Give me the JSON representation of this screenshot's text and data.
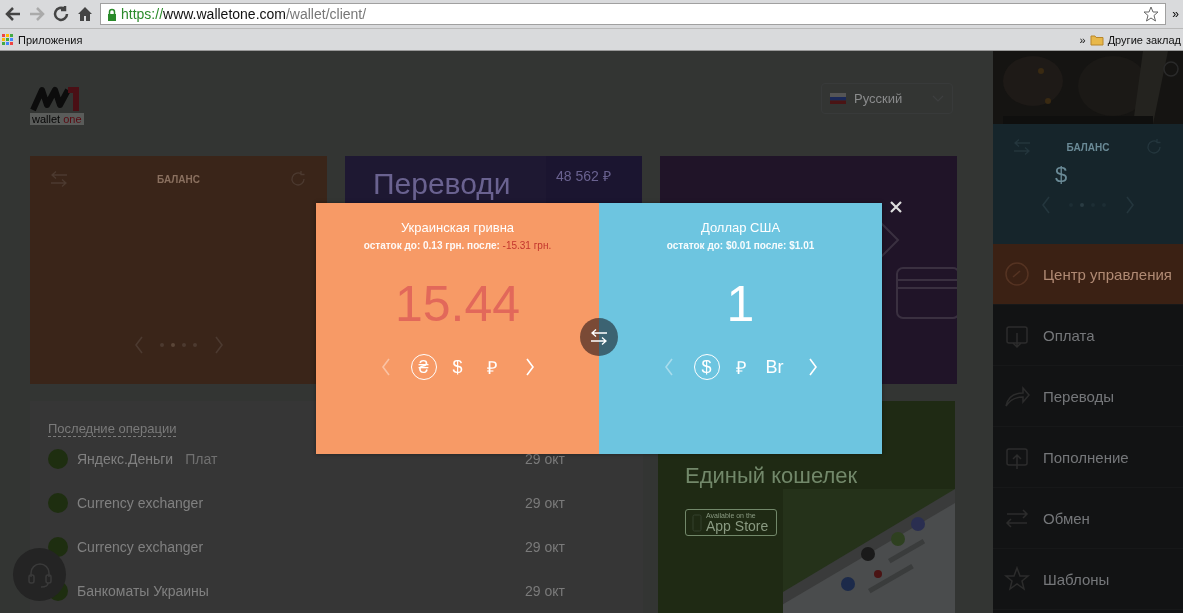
{
  "browser": {
    "url_scheme": "https://",
    "url_host": "www.walletone.com",
    "url_path": "/wallet/client/",
    "bookmark": "Приложения",
    "bookmarks_more": "»",
    "other_bookmarks": "Другие заклад",
    "toolbar_more": "»"
  },
  "header": {
    "logo_word": "wallet",
    "logo_word_accent": "one",
    "language": "Русский"
  },
  "cards": {
    "balance_title": "БАЛАНС",
    "transfers_title": "Переводи",
    "transfers_amount": "48 562 ₽"
  },
  "operations": {
    "title": "Последние операции",
    "rows": [
      {
        "name": "Яндекс.Деньги",
        "detail": "Плат",
        "date": "29 окт"
      },
      {
        "name": "Currency exchanger",
        "date": "29 окт"
      },
      {
        "name": "Currency exchanger",
        "date": "29 окт"
      },
      {
        "name": "Банкоматы Украины",
        "date": "29 окт"
      }
    ]
  },
  "promo": {
    "title": "Единый кошелек",
    "store_line1": "Available on the",
    "store_line2": "App Store"
  },
  "sidebar": {
    "balance_title": "БАЛАНС",
    "currency": "$",
    "menu": [
      {
        "label": "Центр управления",
        "selected": true
      },
      {
        "label": "Оплата",
        "selected": false
      },
      {
        "label": "Переводы",
        "selected": false
      },
      {
        "label": "Пополнение",
        "selected": false
      },
      {
        "label": "Обмен",
        "selected": false
      },
      {
        "label": "Шаблоны",
        "selected": false
      }
    ]
  },
  "exchange_dialog": {
    "panels": [
      {
        "kind": "from",
        "title": "Украинская гривна",
        "balance": "остаток до: 0.13 грн. после:",
        "after": "-15.31 грн.",
        "insufficient": true,
        "amount": "15.44",
        "currencies": [
          {
            "symbol": "₴",
            "selected": true
          },
          {
            "symbol": "$",
            "selected": false
          },
          {
            "symbol": "₽",
            "selected": false
          }
        ]
      },
      {
        "kind": "to",
        "title": "Доллар США",
        "balance": "остаток до: $0.01 после:",
        "after": "$1.01",
        "insufficient": false,
        "amount": "1",
        "currencies": [
          {
            "symbol": "$",
            "selected": true
          },
          {
            "symbol": "₽",
            "selected": false
          },
          {
            "symbol": "Br",
            "selected": false
          }
        ]
      }
    ]
  }
}
